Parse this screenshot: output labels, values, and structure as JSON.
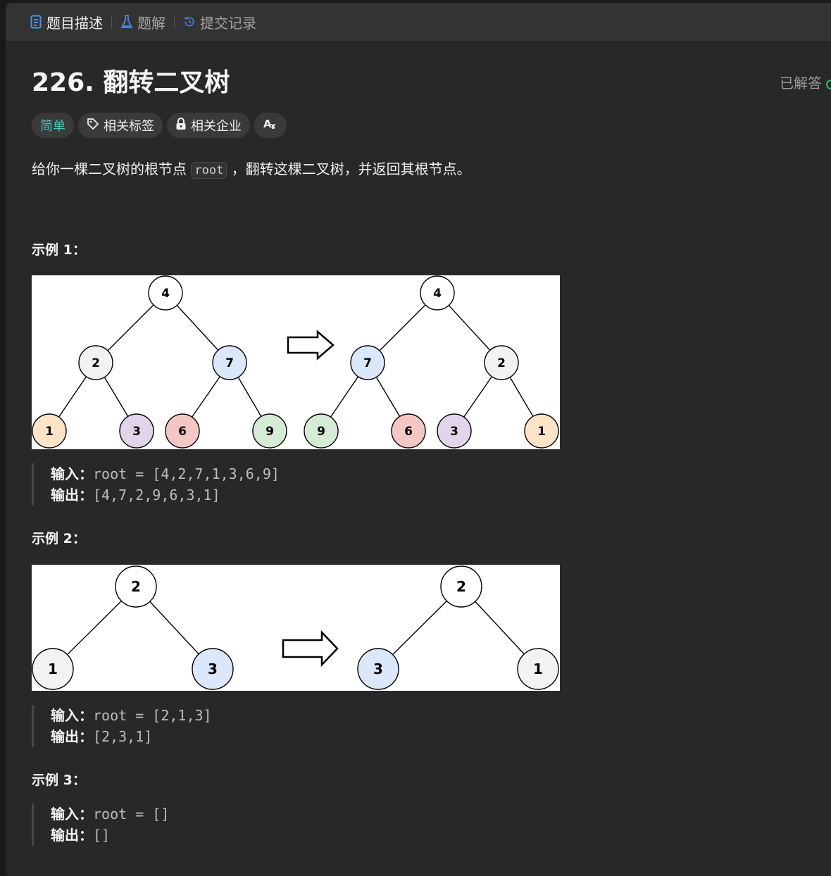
{
  "tabs": [
    {
      "label": "题目描述",
      "icon": "document-icon"
    },
    {
      "label": "题解",
      "icon": "flask-icon"
    },
    {
      "label": "提交记录",
      "icon": "history-icon"
    }
  ],
  "problem": {
    "title": "226. 翻转二叉树",
    "solved_label": "已解答",
    "difficulty": "简单",
    "tags": [
      {
        "label": "相关标签",
        "icon": "tag-icon"
      },
      {
        "label": "相关企业",
        "icon": "lock-icon"
      },
      {
        "label": "Aa",
        "icon": "translate-icon"
      }
    ],
    "desc_before": "给你一棵二叉树的根节点",
    "desc_code": "root",
    "desc_after": "，翻转这棵二叉树，并返回其根节点。"
  },
  "examples": [
    {
      "title": "示例 1：",
      "input_label": "输入：",
      "input": "root = [4,2,7,1,3,6,9]",
      "output_label": "输出：",
      "output": "[4,7,2,9,6,3,1]",
      "before": [
        "4",
        "2",
        "7",
        "1",
        "3",
        "6",
        "9"
      ],
      "after": [
        "4",
        "7",
        "2",
        "9",
        "6",
        "3",
        "1"
      ]
    },
    {
      "title": "示例 2：",
      "input_label": "输入：",
      "input": "root = [2,1,3]",
      "output_label": "输出：",
      "output": "[2,3,1]",
      "before": [
        "2",
        "1",
        "3"
      ],
      "after": [
        "2",
        "3",
        "1"
      ]
    },
    {
      "title": "示例 3：",
      "input_label": "输入：",
      "input": "root = []",
      "output_label": "输出：",
      "output": "[]"
    }
  ],
  "colors": {
    "accent_easy": "#46c6c2",
    "solved_green": "#2cbb5d",
    "node_1": "#fde3c7",
    "node_2": "#f2f2f2",
    "node_3": "#e2d4ea",
    "node_4": "#ffffff",
    "node_6": "#f4c7c3",
    "node_7": "#dbe7fb",
    "node_9": "#d6ebd5"
  }
}
